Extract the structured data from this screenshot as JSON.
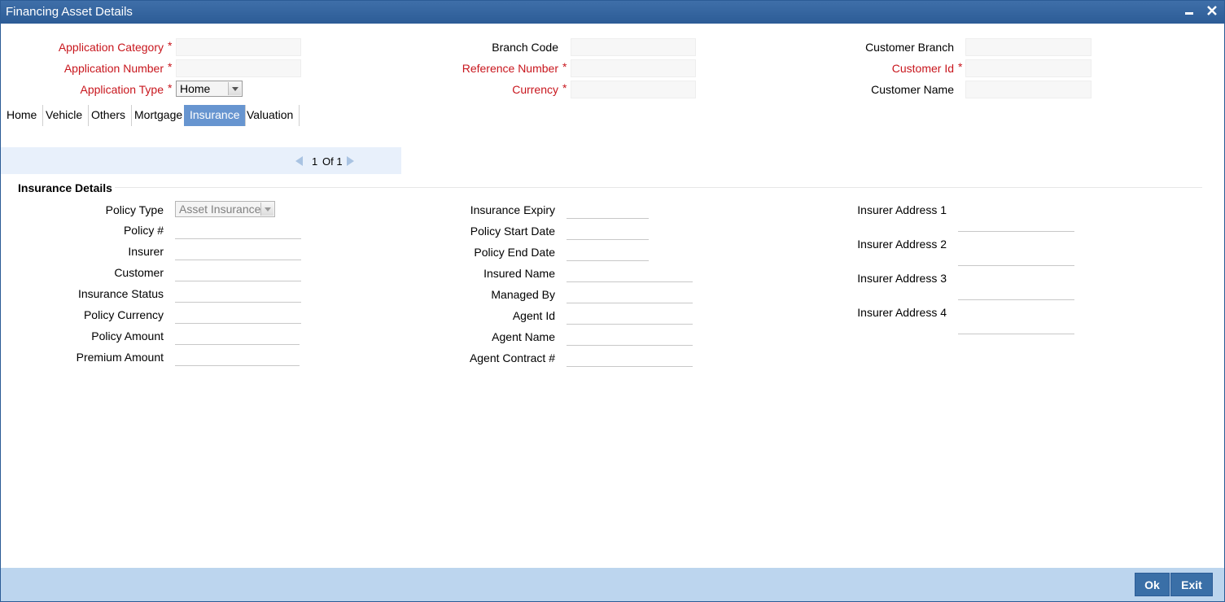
{
  "window": {
    "title": "Financing Asset Details",
    "minimize_glyph": "▃",
    "close_glyph": "✕"
  },
  "header": {
    "application_category": {
      "label": "Application Category",
      "value": ""
    },
    "application_number": {
      "label": "Application Number",
      "value": ""
    },
    "application_type": {
      "label": "Application Type",
      "selected": "Home"
    },
    "branch_code": {
      "label": "Branch Code",
      "value": ""
    },
    "reference_number": {
      "label": "Reference Number",
      "value": ""
    },
    "currency": {
      "label": "Currency",
      "value": ""
    },
    "customer_branch": {
      "label": "Customer Branch",
      "value": ""
    },
    "customer_id": {
      "label": "Customer Id",
      "value": ""
    },
    "customer_name": {
      "label": "Customer Name",
      "value": ""
    },
    "required_mark": "*"
  },
  "tabs": [
    {
      "label": "Home"
    },
    {
      "label": "Vehicle"
    },
    {
      "label": "Others"
    },
    {
      "label": "Mortgage"
    },
    {
      "label": "Insurance",
      "active": true
    },
    {
      "label": "Valuation"
    }
  ],
  "pager": {
    "current": "1",
    "of_text": "Of 1"
  },
  "insurance": {
    "section_title": "Insurance Details",
    "policy_type": {
      "label": "Policy Type",
      "selected": "Asset Insurance"
    },
    "policy_no": {
      "label": "Policy #",
      "value": ""
    },
    "insurer": {
      "label": "Insurer",
      "value": ""
    },
    "customer": {
      "label": "Customer",
      "value": ""
    },
    "insurance_status": {
      "label": "Insurance Status",
      "value": ""
    },
    "policy_currency": {
      "label": "Policy Currency",
      "value": ""
    },
    "policy_amount": {
      "label": "Policy Amount",
      "value": ""
    },
    "premium_amount": {
      "label": "Premium Amount",
      "value": ""
    },
    "insurance_expiry": {
      "label": "Insurance Expiry",
      "value": ""
    },
    "policy_start_date": {
      "label": "Policy Start Date",
      "value": ""
    },
    "policy_end_date": {
      "label": "Policy End Date",
      "value": ""
    },
    "insured_name": {
      "label": "Insured Name",
      "value": ""
    },
    "managed_by": {
      "label": "Managed By",
      "value": ""
    },
    "agent_id": {
      "label": "Agent Id",
      "value": ""
    },
    "agent_name": {
      "label": "Agent Name",
      "value": ""
    },
    "agent_contract_no": {
      "label": "Agent Contract #",
      "value": ""
    },
    "insurer_address_1": {
      "label": "Insurer Address 1",
      "value": ""
    },
    "insurer_address_2": {
      "label": "Insurer Address 2",
      "value": ""
    },
    "insurer_address_3": {
      "label": "Insurer Address 3",
      "value": ""
    },
    "insurer_address_4": {
      "label": "Insurer Address 4",
      "value": ""
    }
  },
  "footer": {
    "ok_label": "Ok",
    "exit_label": "Exit"
  },
  "colors": {
    "titlebar": "#2c5c96",
    "required": "#c8161d",
    "active_tab": "#6795d0",
    "footer": "#bcd5ee",
    "button": "#3a6fa7"
  }
}
